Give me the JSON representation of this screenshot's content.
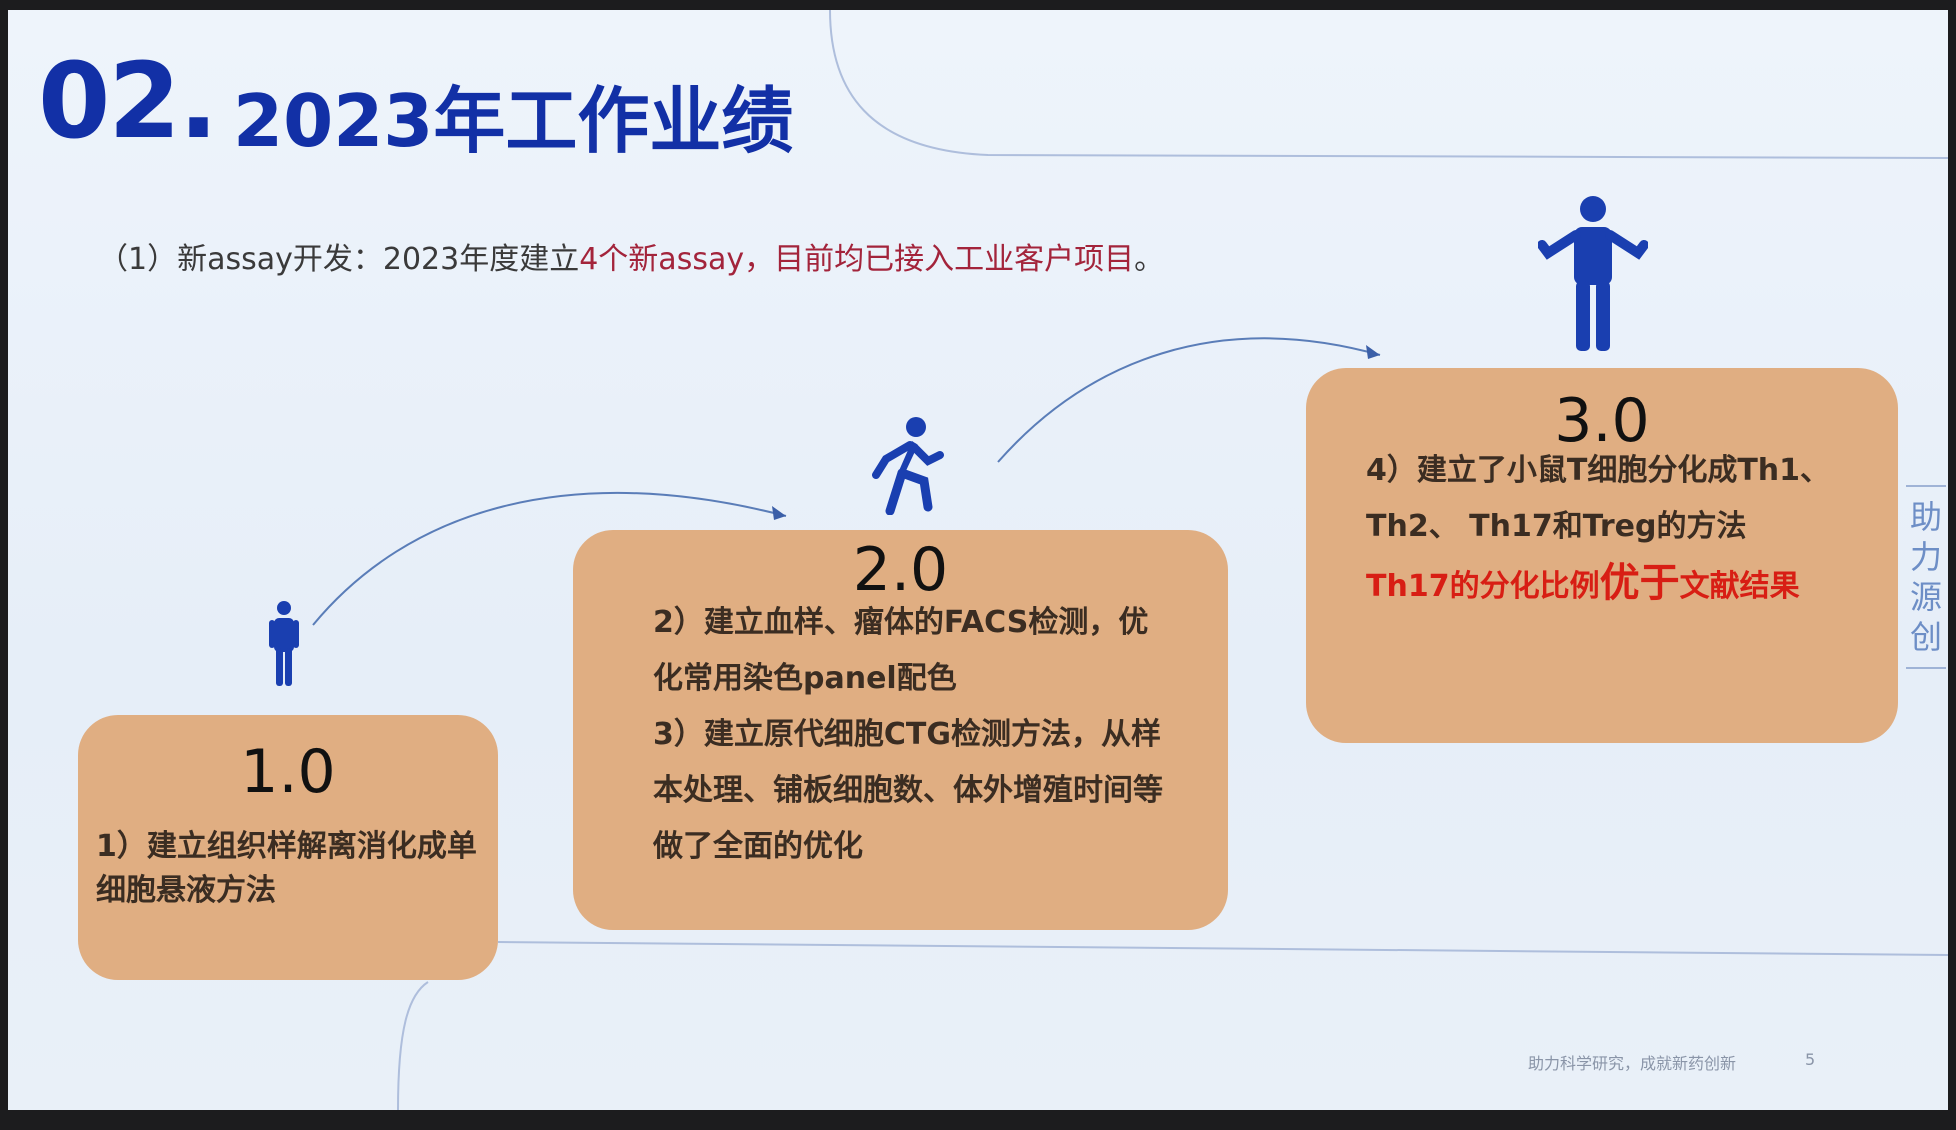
{
  "slide": {
    "number": "02.",
    "title": "2023年工作业绩",
    "intro": {
      "prefix": "（1）新assay开发：2023年度建立",
      "highlight": "4个新assay，目前均已接入工业客户项目",
      "suffix": "。"
    },
    "side_tab": "助力源创",
    "footer": {
      "text": "助力科学研究，成就新药创新",
      "page": "5"
    }
  },
  "cards": [
    {
      "level": "1.0",
      "lines": [
        "1）建立组织样解离消化成单细胞悬液方法"
      ]
    },
    {
      "level": "2.0",
      "lines": [
        "2）建立血样、瘤体的FACS检测，优化常用染色panel配色",
        "3）建立原代细胞CTG检测方法，从样本处理、铺板细胞数、体外增殖时间等做了全面的优化"
      ]
    },
    {
      "level": "3.0",
      "lines": [
        "4）建立了小鼠T细胞分化成Th1、Th2、 Th17和Treg的方法"
      ],
      "result": {
        "pre": "Th17的分化比例",
        "emph": "优于",
        "post": "文献结果"
      }
    }
  ],
  "icons": [
    "person-standing-small-icon",
    "person-climbing-icon",
    "person-standing-large-icon"
  ],
  "colors": {
    "title": "#1230a6",
    "card": "#e0ae82",
    "highlight": "#a3243b",
    "result": "#d81e14",
    "icon": "#1a3fb0"
  }
}
